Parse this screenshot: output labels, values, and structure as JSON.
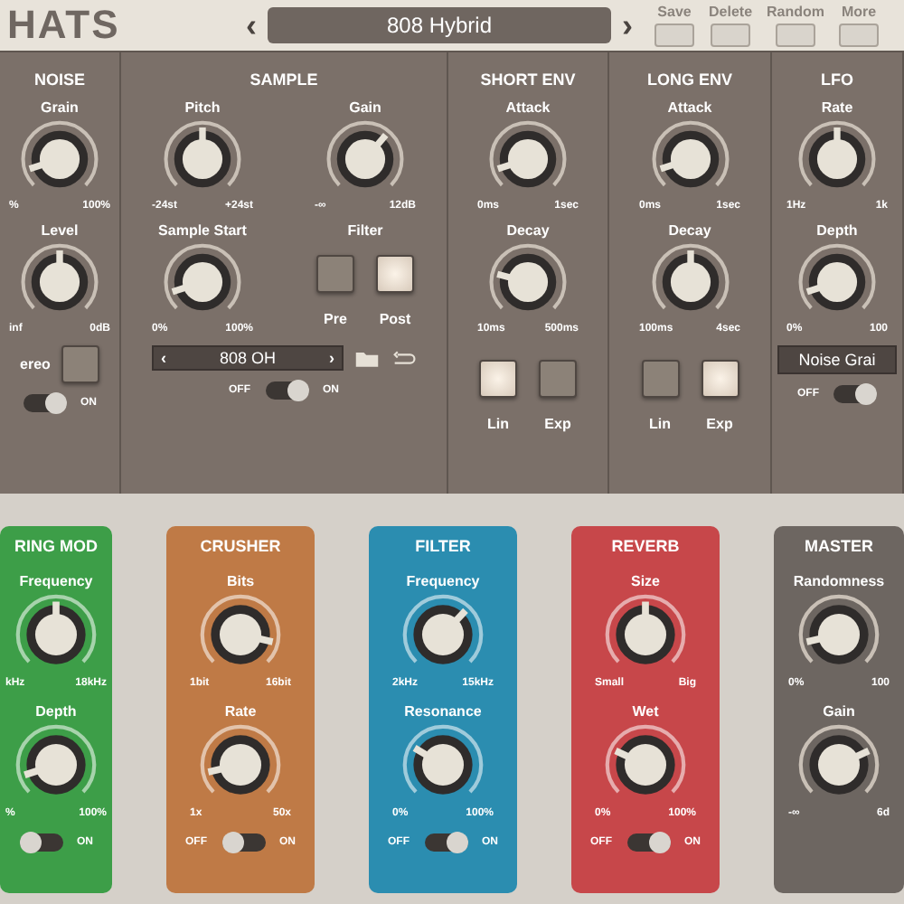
{
  "header": {
    "logo": "HATS",
    "prev": "‹",
    "preset": "808 Hybrid",
    "next": "›",
    "actions": [
      {
        "label": "Save"
      },
      {
        "label": "Delete"
      },
      {
        "label": "Random"
      },
      {
        "label": "More"
      }
    ]
  },
  "sections": [
    {
      "title": "NOISE",
      "items": [
        {
          "kind": "knob",
          "label": "Grain",
          "level": 0.1,
          "min": "%",
          "max": "100%"
        },
        {
          "kind": "knob",
          "label": "Level",
          "level": 0.5,
          "min": "inf",
          "max": "0dB"
        },
        {
          "kind": "padrow",
          "label": "ereo",
          "on": false
        },
        {
          "kind": "toggle",
          "on_label": "ON",
          "on": true
        }
      ]
    },
    {
      "title": "SAMPLE",
      "items": [
        {
          "kind": "knob",
          "label": "Pitch",
          "level": 0.5,
          "min": "-24st",
          "max": "+24st"
        },
        {
          "kind": "knob",
          "label": "Gain",
          "level": 0.65,
          "min": "-∞",
          "max": "12dB"
        },
        {
          "kind": "knob",
          "label": "Sample Start",
          "level": 0.1,
          "min": "0%",
          "max": "100%"
        },
        {
          "kind": "pads",
          "label": "Filter",
          "pads": [
            {
              "label": "Pre",
              "on": false
            },
            {
              "label": "Post",
              "on": true
            }
          ]
        },
        {
          "kind": "selector",
          "prev": "‹",
          "value": "808 OH",
          "next": "›"
        },
        {
          "kind": "toggle",
          "off_label": "OFF",
          "on_label": "ON",
          "on": true
        }
      ]
    },
    {
      "title": "SHORT ENV",
      "items": [
        {
          "kind": "knob",
          "label": "Attack",
          "level": 0.1,
          "min": "0ms",
          "max": "1sec"
        },
        {
          "kind": "knob",
          "label": "Decay",
          "level": 0.22,
          "min": "10ms",
          "max": "500ms"
        },
        {
          "kind": "pads",
          "pads": [
            {
              "label": "Lin",
              "on": true
            },
            {
              "label": "Exp",
              "on": false
            }
          ]
        }
      ]
    },
    {
      "title": "LONG ENV",
      "items": [
        {
          "kind": "knob",
          "label": "Attack",
          "level": 0.1,
          "min": "0ms",
          "max": "1sec"
        },
        {
          "kind": "knob",
          "label": "Decay",
          "level": 0.5,
          "min": "100ms",
          "max": "4sec"
        },
        {
          "kind": "pads",
          "pads": [
            {
              "label": "Lin",
              "on": false
            },
            {
              "label": "Exp",
              "on": true
            }
          ]
        }
      ]
    },
    {
      "title": "LFO",
      "items": [
        {
          "kind": "knob",
          "label": "Rate",
          "level": 0.5,
          "min": "1Hz",
          "max": "1k"
        },
        {
          "kind": "knob",
          "label": "Depth",
          "level": 0.1,
          "min": "0%",
          "max": "100"
        },
        {
          "kind": "display",
          "value": "Noise Grai"
        },
        {
          "kind": "toggle",
          "off_label": "OFF",
          "on": true
        }
      ]
    }
  ],
  "effects": [
    {
      "title": "RING MOD",
      "color": "#3d9e48",
      "knobs": [
        {
          "label": "Frequency",
          "level": 0.5,
          "min": "kHz",
          "max": "18kHz"
        },
        {
          "label": "Depth",
          "level": 0.1,
          "min": "%",
          "max": "100%"
        }
      ],
      "toggle": {
        "on_label": "ON",
        "on": false
      }
    },
    {
      "title": "CRUSHER",
      "color": "#bf7a46",
      "knobs": [
        {
          "label": "Bits",
          "level": 0.88,
          "min": "1bit",
          "max": "16bit"
        },
        {
          "label": "Rate",
          "level": 0.12,
          "min": "1x",
          "max": "50x"
        }
      ],
      "toggle": {
        "off_label": "OFF",
        "on_label": "ON",
        "on": false
      }
    },
    {
      "title": "FILTER",
      "color": "#2b8db0",
      "knobs": [
        {
          "label": "Frequency",
          "level": 0.66,
          "min": "2kHz",
          "max": "15kHz"
        },
        {
          "label": "Resonance",
          "level": 0.28,
          "min": "0%",
          "max": "100%"
        }
      ],
      "toggle": {
        "off_label": "OFF",
        "on_label": "ON",
        "on": true
      }
    },
    {
      "title": "REVERB",
      "color": "#c7474a",
      "knobs": [
        {
          "label": "Size",
          "level": 0.5,
          "min": "Small",
          "max": "Big"
        },
        {
          "label": "Wet",
          "level": 0.26,
          "min": "0%",
          "max": "100%"
        }
      ],
      "toggle": {
        "off_label": "OFF",
        "on_label": "ON",
        "on": true
      }
    },
    {
      "title": "MASTER",
      "color": "#6d6661",
      "knobs": [
        {
          "label": "Randomness",
          "level": 0.12,
          "min": "0%",
          "max": "100"
        },
        {
          "label": "Gain",
          "level": 0.74,
          "min": "-∞",
          "max": "6d"
        }
      ]
    }
  ]
}
